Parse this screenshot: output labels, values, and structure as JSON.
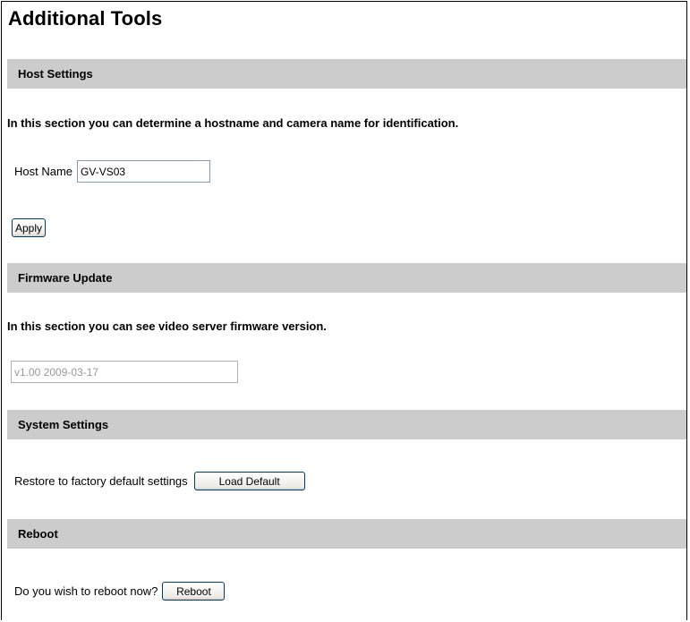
{
  "page": {
    "title": "Additional Tools"
  },
  "host_settings": {
    "header": "Host Settings",
    "description": "In this section you can determine a hostname and camera name for identification.",
    "host_name_label": "Host Name",
    "host_name_value": "GV-VS03",
    "apply_label": "Apply"
  },
  "firmware_update": {
    "header": "Firmware Update",
    "description": "In this section you can see video server firmware version.",
    "version_value": "v1.00 2009-03-17"
  },
  "system_settings": {
    "header": "System Settings",
    "restore_label": "Restore to factory default settings",
    "load_default_label": "Load Default"
  },
  "reboot": {
    "header": "Reboot",
    "question_label": "Do you wish to reboot now?",
    "reboot_label": "Reboot"
  },
  "colors": {
    "section_bar": "#cccccc",
    "disabled_text": "#999999"
  }
}
